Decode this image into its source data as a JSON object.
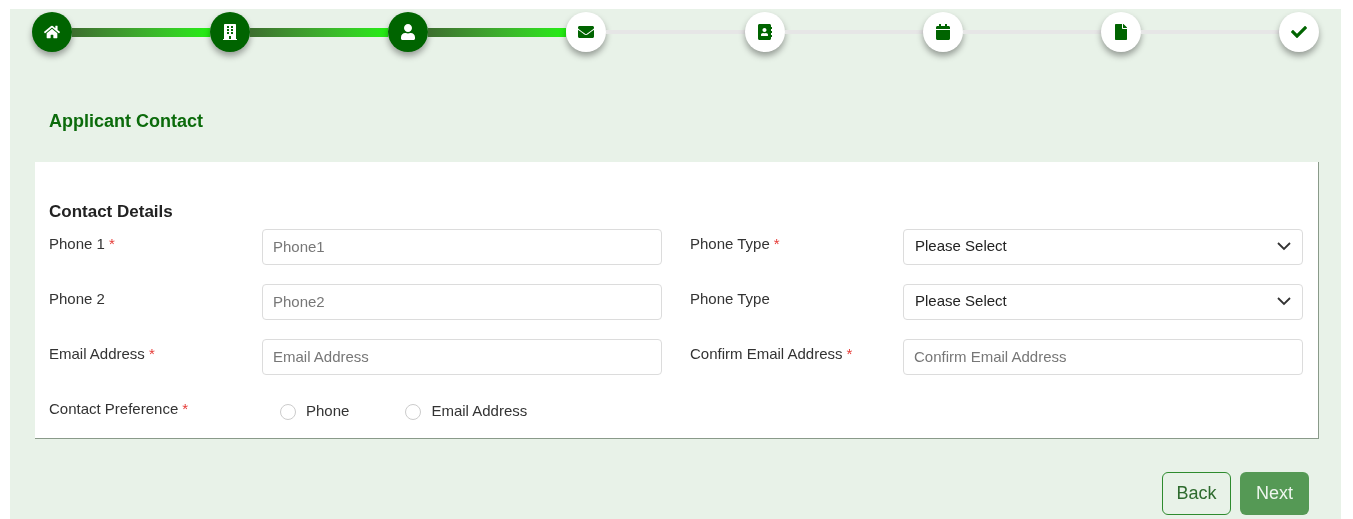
{
  "steps": [
    {
      "completed": true
    },
    {
      "completed": true
    },
    {
      "completed": true
    },
    {
      "completed": false
    },
    {
      "completed": false
    },
    {
      "completed": false
    },
    {
      "completed": false
    },
    {
      "completed": false
    }
  ],
  "page_title": "Applicant Contact",
  "section_title": "Contact Details",
  "fields": [
    {
      "kind": "input",
      "label": "Phone 1",
      "required_mark": "*",
      "placeholder": "Phone1"
    },
    {
      "kind": "select",
      "label": "Phone Type",
      "required_mark": "*",
      "value": "Please Select"
    },
    {
      "kind": "input",
      "label": "Phone 2",
      "placeholder": "Phone2"
    },
    {
      "kind": "select",
      "label": "Phone Type",
      "value": "Please Select"
    },
    {
      "kind": "input",
      "label": "Email Address",
      "required_mark": "*",
      "placeholder": "Email Address"
    },
    {
      "kind": "input",
      "label": "Confirm Email Address",
      "required_mark": "*",
      "placeholder": "Confirm Email Address"
    },
    {
      "kind": "radio",
      "label": "Contact Preference",
      "required_mark": "*",
      "options": [
        {
          "label": "Phone",
          "selected": false
        },
        {
          "label": "Email Address",
          "selected": false
        }
      ]
    }
  ],
  "buttons": [
    {
      "kind": "secondary",
      "label": "Back"
    },
    {
      "kind": "primary",
      "label": "Next"
    }
  ]
}
